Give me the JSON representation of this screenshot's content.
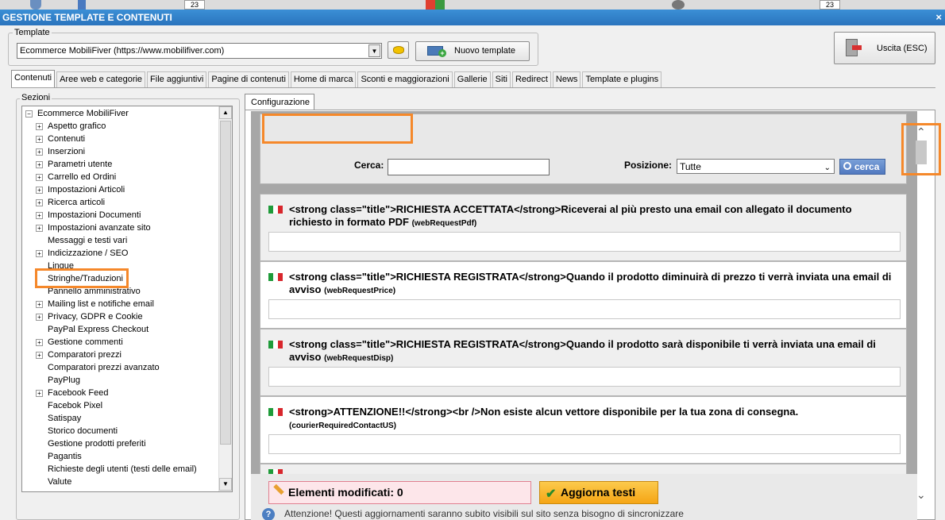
{
  "window": {
    "title": "GESTIONE TEMPLATE E CONTENUTI",
    "close_glyph": "×"
  },
  "taskbar_fragments": [
    "23",
    "23"
  ],
  "template": {
    "legend": "Template",
    "selected": "Ecommerce MobiliFiver (https://www.mobilifiver.com)",
    "new_button": "Nuovo template",
    "exit_button": "Uscita (ESC)"
  },
  "tabs": [
    "Contenuti",
    "Aree web e categorie",
    "File aggiuntivi",
    "Pagine di contenuti",
    "Home di marca",
    "Sconti e maggiorazioni",
    "Gallerie",
    "Siti",
    "Redirect",
    "News",
    "Template e plugins"
  ],
  "sections": {
    "legend": "Sezioni",
    "root": "Ecommerce MobiliFiver",
    "items": [
      {
        "label": "Aspetto grafico",
        "expandable": true
      },
      {
        "label": "Contenuti",
        "expandable": true
      },
      {
        "label": "Inserzioni",
        "expandable": true
      },
      {
        "label": "Parametri utente",
        "expandable": true
      },
      {
        "label": "Carrello ed Ordini",
        "expandable": true
      },
      {
        "label": "Impostazioni Articoli",
        "expandable": true
      },
      {
        "label": "Ricerca articoli",
        "expandable": true
      },
      {
        "label": "Impostazioni Documenti",
        "expandable": true
      },
      {
        "label": "Impostazioni avanzate sito",
        "expandable": true
      },
      {
        "label": "Messaggi e testi vari",
        "expandable": false
      },
      {
        "label": "Indicizzazione / SEO",
        "expandable": true
      },
      {
        "label": "Lingue",
        "expandable": false
      },
      {
        "label": "Stringhe/Traduzioni",
        "expandable": false,
        "selected": true
      },
      {
        "label": "Pannello amministrativo",
        "expandable": false
      },
      {
        "label": "Mailing list e notifiche email",
        "expandable": true
      },
      {
        "label": "Privacy, GDPR e Cookie",
        "expandable": true
      },
      {
        "label": "PayPal Express Checkout",
        "expandable": false
      },
      {
        "label": "Gestione commenti",
        "expandable": true
      },
      {
        "label": "Comparatori prezzi",
        "expandable": true
      },
      {
        "label": "Comparatori prezzi avanzato",
        "expandable": false
      },
      {
        "label": "PayPlug",
        "expandable": false
      },
      {
        "label": "Facebook Feed",
        "expandable": true
      },
      {
        "label": "Facebok Pixel",
        "expandable": false
      },
      {
        "label": "Satispay",
        "expandable": false
      },
      {
        "label": "Storico documenti",
        "expandable": false
      },
      {
        "label": "Gestione prodotti preferiti",
        "expandable": false
      },
      {
        "label": "Pagantis",
        "expandable": false
      },
      {
        "label": "Richieste degli utenti (testi delle email)",
        "expandable": false
      },
      {
        "label": "Valute",
        "expandable": false
      }
    ]
  },
  "config": {
    "tab": "Configurazione",
    "search_label": "Cerca:",
    "search_value": "",
    "position_label": "Posizione:",
    "position_value": "Tutte",
    "search_button": "cerca"
  },
  "entries": [
    {
      "text": "<strong class=\"title\">RICHIESTA ACCETTATA</strong>Riceverai al più presto una email con allegato il documento richiesto in formato PDF",
      "key": "(webRequestPdf)",
      "value": ""
    },
    {
      "text": "<strong class=\"title\">RICHIESTA REGISTRATA</strong>Quando il prodotto diminuirà di prezzo ti verrà inviata una email di avviso",
      "key": "(webRequestPrice)",
      "value": ""
    },
    {
      "text": "<strong class=\"title\">RICHIESTA REGISTRATA</strong>Quando il prodotto sarà disponibile ti verrà inviata una email di avviso",
      "key": "(webRequestDisp)",
      "value": ""
    },
    {
      "text": "<strong>ATTENZIONE!!</strong><br />Non esiste alcun vettore disponibile per la tua zona di consegna.",
      "key": "(courierRequiredContactUS)",
      "value": ""
    }
  ],
  "footer": {
    "modified_label": "Elementi modificati: 0",
    "update_button": "Aggiorna testi",
    "warning": "Attenzione! Questi aggiornamenti saranno subito visibili sul sito senza bisogno di sincronizzare"
  },
  "colors": {
    "title_bar": "#2a74bd",
    "highlight": "#f5882a",
    "update_button": "#f5a515",
    "modified_box": "#fde6ea"
  }
}
